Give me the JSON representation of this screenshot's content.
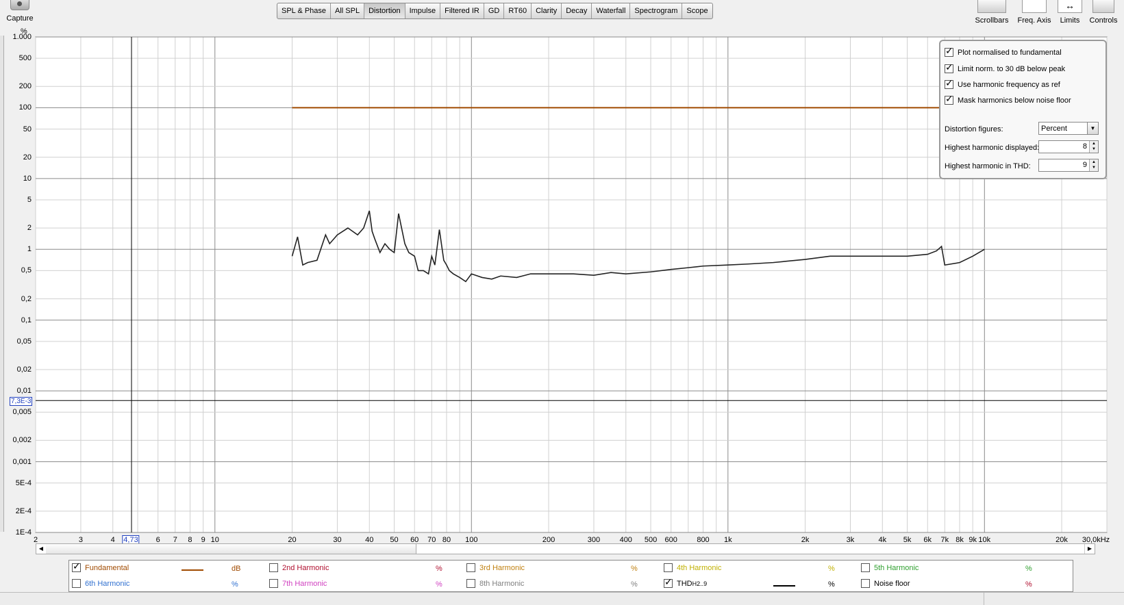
{
  "toolbar": {
    "capture_label": "Capture",
    "tabs": [
      "SPL & Phase",
      "All SPL",
      "Distortion",
      "Impulse",
      "Filtered IR",
      "GD",
      "RT60",
      "Clarity",
      "Decay",
      "Waterfall",
      "Spectrogram",
      "Scope"
    ],
    "active_tab": "Distortion",
    "right_tools": [
      "Scrollbars",
      "Freq. Axis",
      "Limits",
      "Controls"
    ]
  },
  "axis": {
    "y_unit": "%",
    "y_ticks": [
      "1.000",
      "500",
      "200",
      "100",
      "50",
      "20",
      "10",
      "5",
      "2",
      "1",
      "0,5",
      "0,2",
      "0,1",
      "0,05",
      "0,02",
      "0,01",
      "0,005",
      "0,002",
      "0,001",
      "5E-4",
      "2E-4",
      "1E-4"
    ],
    "x_ticks": [
      "2",
      "3",
      "4",
      "6",
      "7",
      "8",
      "9",
      "10",
      "20",
      "30",
      "40",
      "50",
      "60",
      "70",
      "80",
      "100",
      "200",
      "300",
      "400",
      "500",
      "600",
      "800",
      "1k",
      "2k",
      "3k",
      "4k",
      "5k",
      "6k",
      "7k",
      "8k",
      "9k",
      "10k",
      "20k",
      "30,0kHz"
    ],
    "x_cursor": "4,73",
    "y_cursor": "7,3E-3"
  },
  "controls": {
    "checkboxes": [
      {
        "label": "Plot normalised to fundamental",
        "checked": true
      },
      {
        "label": "Limit norm. to 30 dB below peak",
        "checked": true
      },
      {
        "label": "Use harmonic frequency as ref",
        "checked": true
      },
      {
        "label": "Mask harmonics below noise floor",
        "checked": true
      }
    ],
    "distortion_figures_label": "Distortion figures:",
    "distortion_figures_value": "Percent",
    "highest_displayed_label": "Highest harmonic displayed:",
    "highest_displayed_value": "8",
    "highest_thd_label": "Highest harmonic in THD:",
    "highest_thd_value": "9"
  },
  "legend": [
    {
      "label": "Fundamental",
      "unit": "dB",
      "checked": true,
      "color": "#a04a00",
      "line": true
    },
    {
      "label": "2nd Harmonic",
      "unit": "%",
      "checked": false,
      "color": "#b01030"
    },
    {
      "label": "3rd Harmonic",
      "unit": "%",
      "checked": false,
      "color": "#c08010"
    },
    {
      "label": "4th Harmonic",
      "unit": "%",
      "checked": false,
      "color": "#c0b000"
    },
    {
      "label": "5th Harmonic",
      "unit": "%",
      "checked": false,
      "color": "#30a030"
    },
    {
      "label": "6th Harmonic",
      "unit": "%",
      "checked": false,
      "color": "#3070d0"
    },
    {
      "label": "7th Harmonic",
      "unit": "%",
      "checked": false,
      "color": "#d040c0"
    },
    {
      "label": "8th Harmonic",
      "unit": "%",
      "checked": false,
      "color": "#808080"
    },
    {
      "label": "THD",
      "sub": "H2..9",
      "unit": "%",
      "checked": true,
      "color": "#000000",
      "line": true
    },
    {
      "label": "Noise floor",
      "unit": "%",
      "checked": false,
      "color": "#000000"
    }
  ],
  "chart_data": {
    "type": "line",
    "xlim": [
      2,
      30000
    ],
    "ylim": [
      0.0001,
      1000
    ],
    "x_scale": "log",
    "y_scale": "log",
    "series": [
      {
        "name": "Fundamental",
        "x": [
          20,
          10000
        ],
        "values": [
          100,
          100
        ]
      },
      {
        "name": "THD",
        "x": [
          20,
          21,
          22,
          23,
          25,
          27,
          28,
          30,
          33,
          36,
          38,
          40,
          41,
          42,
          44,
          46,
          48,
          50,
          52,
          55,
          57,
          60,
          62,
          65,
          68,
          70,
          72,
          75,
          78,
          80,
          82,
          85,
          90,
          95,
          100,
          110,
          120,
          130,
          150,
          170,
          200,
          250,
          300,
          350,
          400,
          500,
          600,
          700,
          800,
          1000,
          1200,
          1500,
          2000,
          2500,
          3000,
          4000,
          5000,
          6000,
          6500,
          6800,
          7000,
          8000,
          9000,
          10000
        ],
        "values": [
          0.8,
          1.5,
          0.6,
          0.65,
          0.7,
          1.6,
          1.2,
          1.6,
          2.0,
          1.6,
          2.0,
          3.5,
          1.8,
          1.4,
          0.9,
          1.2,
          1.0,
          0.9,
          3.2,
          1.2,
          0.9,
          0.8,
          0.5,
          0.5,
          0.45,
          0.8,
          0.6,
          1.9,
          0.7,
          0.6,
          0.5,
          0.45,
          0.4,
          0.35,
          0.45,
          0.4,
          0.38,
          0.42,
          0.4,
          0.45,
          0.45,
          0.45,
          0.43,
          0.47,
          0.45,
          0.48,
          0.52,
          0.55,
          0.58,
          0.6,
          0.62,
          0.65,
          0.72,
          0.8,
          0.8,
          0.8,
          0.8,
          0.85,
          0.95,
          1.1,
          0.6,
          0.65,
          0.8,
          1.0
        ]
      }
    ]
  }
}
